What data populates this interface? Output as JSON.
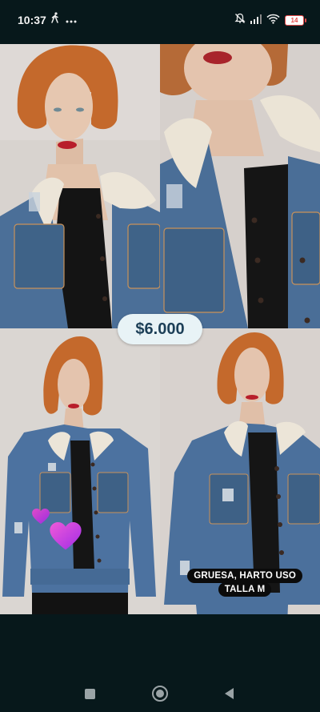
{
  "status_bar": {
    "time": "10:37",
    "battery": "14",
    "left_icons": [
      "walking-icon",
      "more-dots-icon"
    ],
    "right_icons": [
      "mute-icon",
      "signal-icon",
      "wifi-icon",
      "battery-icon"
    ],
    "battery_color": "#e64a4a"
  },
  "story": {
    "price": "$6.000",
    "caption_line1": "GRUESA, HARTO USO",
    "caption_line2": "TALLA M",
    "sticker": "purple-hearts",
    "photos": [
      "jacket-closeup-left",
      "jacket-closeup-right",
      "jacket-full-left",
      "jacket-full-right"
    ]
  },
  "nav_bar": {
    "buttons": [
      "recent-apps",
      "home",
      "back"
    ]
  },
  "colors": {
    "background": "#07181b",
    "price_pill_bg": "#e8f3f6",
    "price_text": "#1c3f57",
    "heart": "#c23ad6"
  }
}
